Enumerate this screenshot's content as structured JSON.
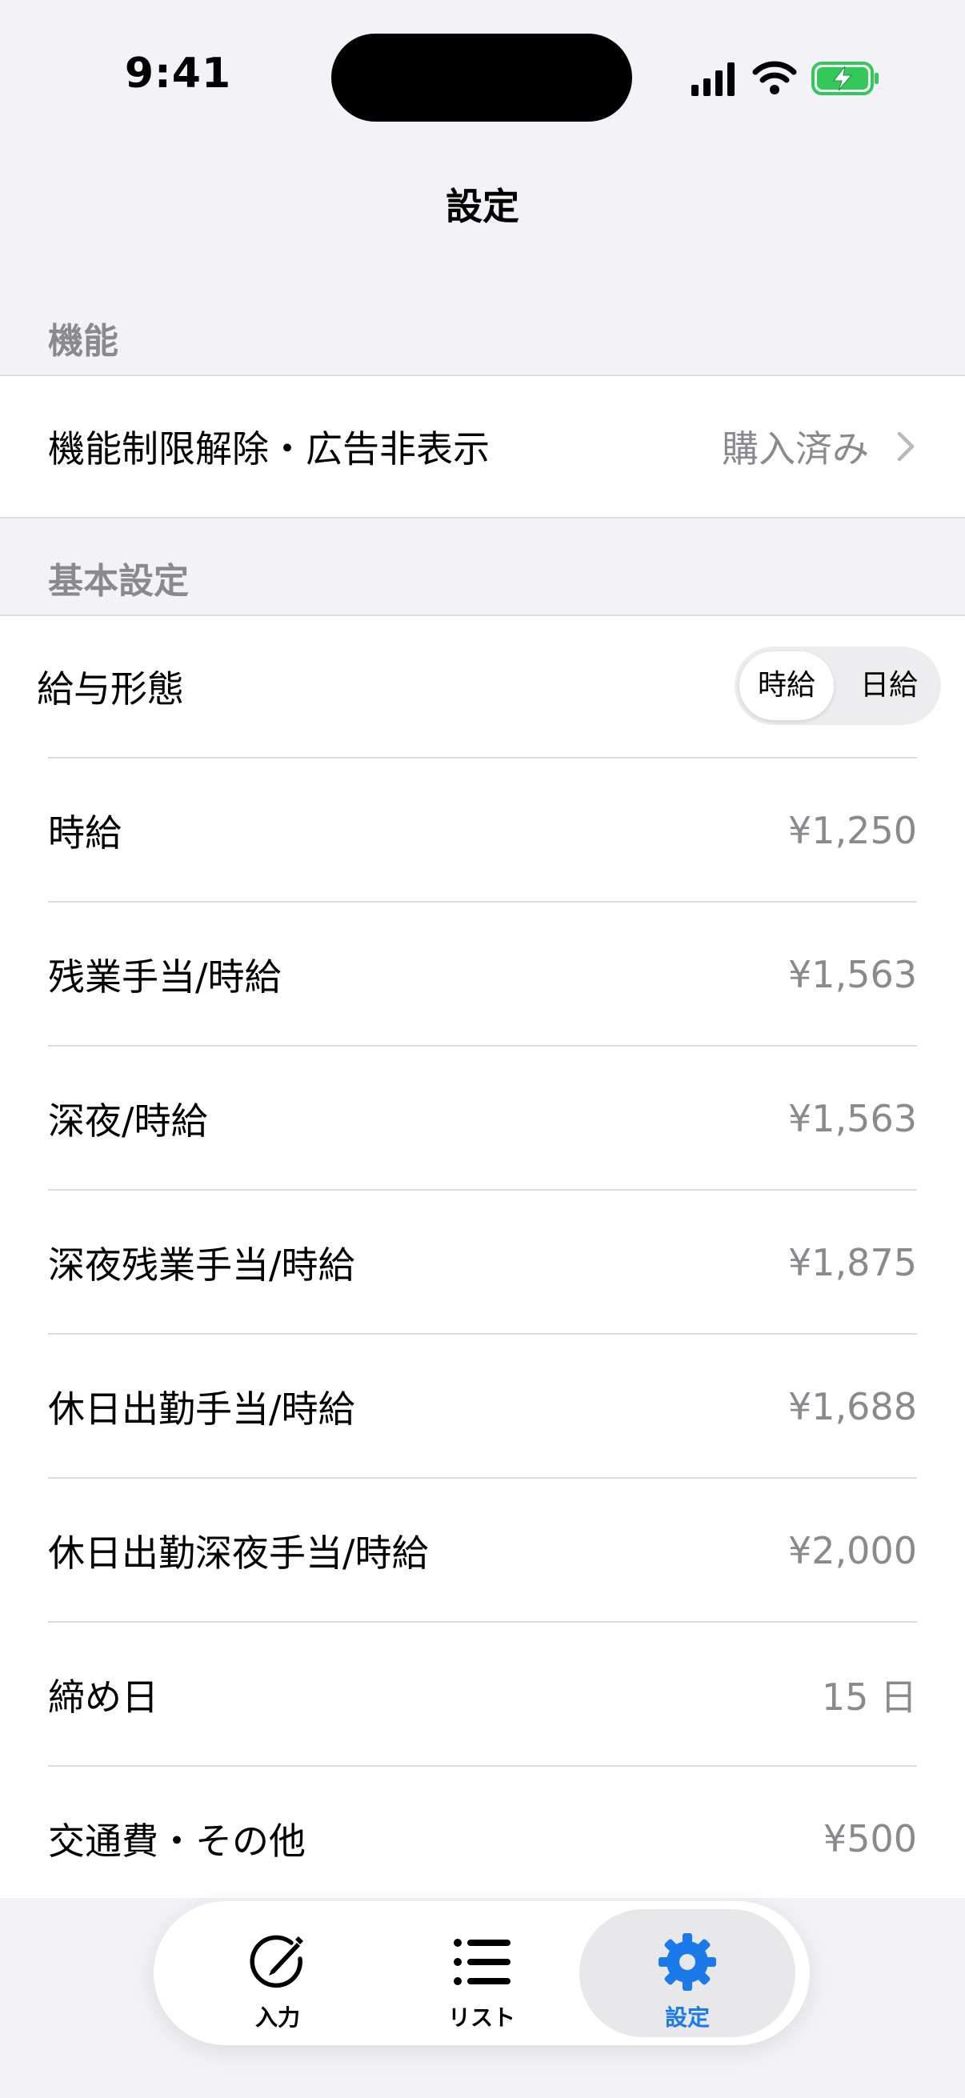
{
  "status_bar": {
    "time": "9:41"
  },
  "nav": {
    "title": "設定"
  },
  "sections": {
    "features": {
      "header": "機能",
      "purchase_row": {
        "label": "機能制限解除・広告非表示",
        "value": "購入済み"
      }
    },
    "basic": {
      "header": "基本設定",
      "pay_type": {
        "label": "給与形態",
        "options": [
          "時給",
          "日給"
        ],
        "selected": "時給"
      },
      "rows": [
        {
          "label": "時給",
          "value": "¥1,250"
        },
        {
          "label": "残業手当/時給",
          "value": "¥1,563"
        },
        {
          "label": "深夜/時給",
          "value": "¥1,563"
        },
        {
          "label": "深夜残業手当/時給",
          "value": "¥1,875"
        },
        {
          "label": "休日出勤手当/時給",
          "value": "¥1,688"
        },
        {
          "label": "休日出勤深夜手当/時給",
          "value": "¥2,000"
        },
        {
          "label": "締め日",
          "value": "15 日"
        },
        {
          "label": "交通費・その他",
          "value": "¥500"
        }
      ]
    }
  },
  "tab_bar": {
    "tabs": [
      {
        "label": "入力",
        "icon": "pencil-circle-icon",
        "selected": false
      },
      {
        "label": "リスト",
        "icon": "list-icon",
        "selected": false
      },
      {
        "label": "設定",
        "icon": "gear-icon",
        "selected": true
      }
    ]
  },
  "colors": {
    "accent": "#1A7AEA",
    "background": "#F2F2F7",
    "secondary_text": "#8A8A8E",
    "battery_green": "#34C759"
  }
}
